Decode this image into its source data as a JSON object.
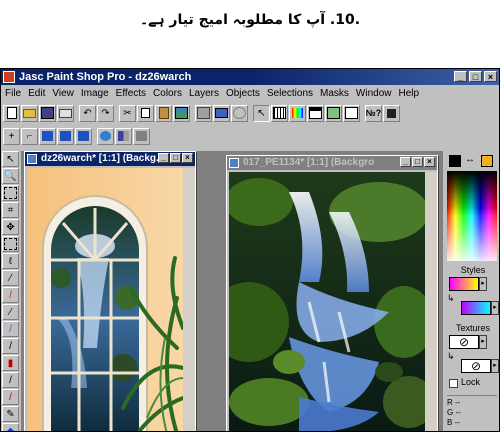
{
  "caption": ".10. آپ کا مطلوبہ امیج تیار ہے۔",
  "app": {
    "title": "Jasc Paint Shop Pro - dz26warch",
    "window_buttons": [
      "_",
      "□",
      "×"
    ]
  },
  "menu": [
    "File",
    "Edit",
    "View",
    "Image",
    "Effects",
    "Colors",
    "Layers",
    "Objects",
    "Selections",
    "Masks",
    "Window",
    "Help"
  ],
  "documents": [
    {
      "title": "dz26warch* [1:1] (Backg...",
      "buttons": [
        "_",
        "□",
        "×"
      ]
    },
    {
      "title": "017_PE1134* [1:1] (Backgro",
      "buttons": [
        "_",
        "□",
        "×"
      ]
    }
  ],
  "panel": {
    "styles_label": "Styles",
    "textures_label": "Textures",
    "lock_label": "Lock",
    "rgb_labels": [
      "R",
      "G",
      "B"
    ],
    "rgb_values": [
      "--",
      "--",
      "--"
    ],
    "colors": {
      "foreground": "#000000",
      "background": "#f0b020",
      "accent": "#0a246a"
    }
  },
  "icons": {
    "toolbar1": [
      "new-icon",
      "open-icon",
      "save-icon",
      "print-icon",
      "undo-icon",
      "redo-icon",
      "cut-icon",
      "copy-icon",
      "paste-icon",
      "image-icon",
      "browse-icon",
      "display-icon",
      "color-icon",
      "histogram-icon",
      "grid-icon",
      "layers-icon",
      "help-icon",
      "exit-icon"
    ],
    "toolbar2": [
      "crosshair-icon",
      "crop-icon",
      "nav-left-icon",
      "nav-right-icon",
      "zoom-icon",
      "web-icon",
      "tile-icon",
      "overview-icon"
    ]
  }
}
